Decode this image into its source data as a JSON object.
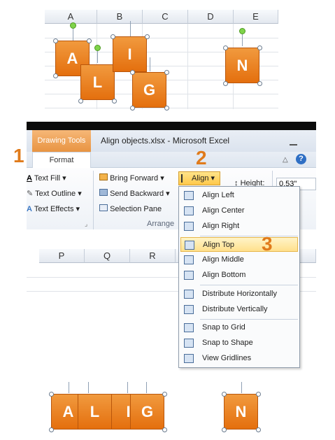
{
  "top_grid": {
    "columns": [
      "A",
      "B",
      "C",
      "D",
      "E"
    ]
  },
  "shapes_before": [
    "A",
    "L",
    "I",
    "G",
    "N"
  ],
  "shapes_after": [
    "A",
    "L",
    "I",
    "G",
    "N"
  ],
  "ribbon": {
    "context_tab": "Drawing Tools",
    "format_tab": "Format",
    "window_title": "Align objects.xlsx - Microsoft Excel",
    "text_fill": "Text Fill",
    "text_outline": "Text Outline",
    "text_effects": "Text Effects",
    "bring_forward": "Bring Forward",
    "send_backward": "Send Backward",
    "selection_pane": "Selection Pane",
    "arrange_group": "Arrange",
    "align_button": "Align",
    "height_label": "Height:",
    "height_value": "0.53\""
  },
  "mid_grid": {
    "columns": [
      "P",
      "Q",
      "R"
    ]
  },
  "menu": {
    "items": [
      "Align Left",
      "Align Center",
      "Align Right",
      "Align Top",
      "Align Middle",
      "Align Bottom",
      "Distribute Horizontally",
      "Distribute Vertically",
      "Snap to Grid",
      "Snap to Shape",
      "View Gridlines"
    ],
    "highlighted": "Align Top"
  },
  "steps": [
    "1",
    "2",
    "3"
  ],
  "colors": {
    "shape_orange": "#e8781a",
    "step_orange": "#e07b1b",
    "highlight": "#ffe08c"
  }
}
